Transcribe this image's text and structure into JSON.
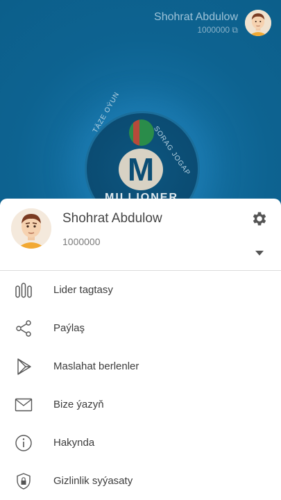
{
  "header": {
    "user_name": "Shohrat Abdulow",
    "coins": "1000000"
  },
  "logo": {
    "arc_left": "TÄZE OÝUN",
    "arc_right": "SORAG JOGAP",
    "letter": "M",
    "band": "MILLIONER"
  },
  "drawer": {
    "user_name": "Shohrat Abdulow",
    "coins": "1000000",
    "menu": [
      {
        "label": "Lider tagtasy",
        "icon": "leaderboard-icon"
      },
      {
        "label": "Paýlaş",
        "icon": "share-icon"
      },
      {
        "label": "Maslahat berlenler",
        "icon": "play-store-icon"
      },
      {
        "label": "Bize ýazyň",
        "icon": "mail-icon"
      },
      {
        "label": "Hakynda",
        "icon": "info-icon"
      },
      {
        "label": "Gizlinlik syýasaty",
        "icon": "privacy-lock-icon"
      }
    ]
  },
  "colors": {
    "background": "#0f5f87",
    "drawer": "#ffffff",
    "text": "#3c3c3c"
  }
}
